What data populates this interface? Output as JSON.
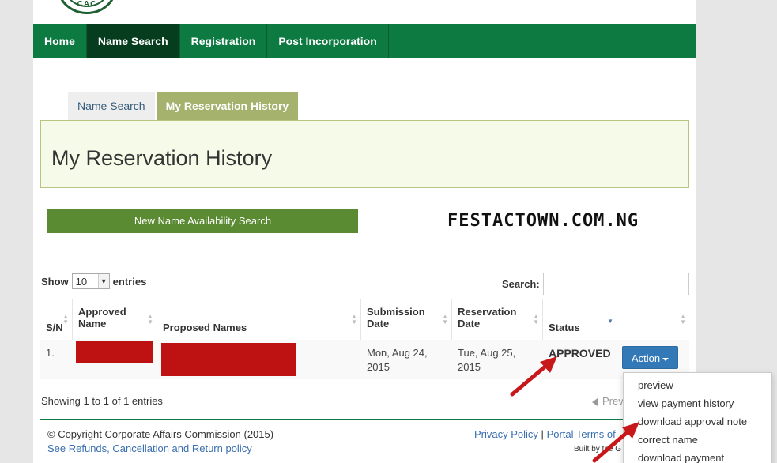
{
  "logo": {
    "text": "CAC"
  },
  "nav": {
    "items": [
      {
        "label": "Home",
        "active": false
      },
      {
        "label": "Name Search",
        "active": true
      },
      {
        "label": "Registration",
        "active": false
      },
      {
        "label": "Post Incorporation",
        "active": false
      }
    ]
  },
  "tabs": [
    {
      "label": "Name Search",
      "active": false
    },
    {
      "label": "My Reservation History",
      "active": true
    }
  ],
  "page_title": "My Reservation History",
  "new_search_button": "New Name Availability Search",
  "watermark": "FESTACTOWN.COM.NG",
  "table_controls": {
    "show_label": "Show",
    "entries_value": "10",
    "entries_label": "entries",
    "search_label": "Search:",
    "search_value": ""
  },
  "table": {
    "headers": [
      "S/N",
      "Approved Name",
      "Proposed Names",
      "Submission Date",
      "Reservation Date",
      "Status",
      ""
    ],
    "rows": [
      {
        "sn": "1.",
        "submission_date": "Mon, Aug 24, 2015",
        "reservation_date": "Tue, Aug 25, 2015",
        "status": "APPROVED",
        "action_label": "Action"
      }
    ]
  },
  "action_menu": [
    "preview",
    "view payment history",
    "download approval note",
    "correct name",
    "download payment receipt"
  ],
  "pagination": {
    "info": "Showing 1 to 1 of 1 entries",
    "prev_label": "Prev"
  },
  "footer": {
    "copyright": "© Copyright Corporate Affairs Commission (2015)",
    "refund_link": "See Refunds, Cancellation and Return policy",
    "privacy_link": "Privacy Policy",
    "separator": "|",
    "terms_link": "Portal Terms of",
    "built_by": "Built by the G"
  },
  "colors": {
    "nav_green": "#0d7a42",
    "nav_active": "#073d1f",
    "tab_active": "#a4b26e",
    "button_green": "#5a8a32",
    "action_blue": "#3479b7",
    "redaction": "#be1212",
    "annotation_arrow": "#c8171a"
  }
}
